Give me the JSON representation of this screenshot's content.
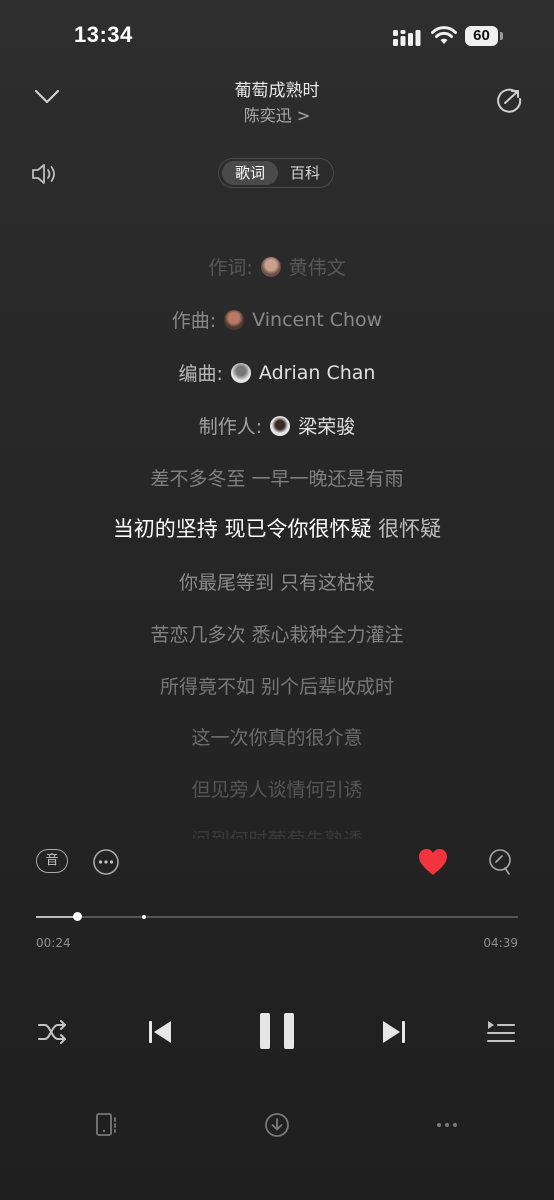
{
  "status_bar": {
    "time": "13:34",
    "battery": "60"
  },
  "header": {
    "song_title": "葡萄成熟时",
    "artist": "陈奕迅 >"
  },
  "tabs": [
    {
      "label": "歌词",
      "active": true
    },
    {
      "label": "百科",
      "active": false
    }
  ],
  "credits": [
    {
      "role": "作词:",
      "name": "黄伟文"
    },
    {
      "role": "作曲:",
      "name": "Vincent Chow"
    },
    {
      "role": "编曲:",
      "name": "Adrian Chan"
    },
    {
      "role": "制作人:",
      "name": "梁荣骏"
    }
  ],
  "lyrics": [
    "差不多冬至 一早一晚还是有雨",
    "当初的坚持 现已令你很怀疑 很怀疑",
    "你最尾等到 只有这枯枝",
    "苦恋几多次 悉心栽种全力灌注",
    "所得竟不如 别个后辈收成时",
    "这一次你真的很介意",
    "但见旁人谈情何引诱",
    "问到何时葡萄先熟透"
  ],
  "current_line": {
    "sung": "当初的坚持 现已令你很怀疑",
    "rest": " 很怀疑"
  },
  "controls": {
    "sound_effect_label": "音",
    "liked": true
  },
  "playback": {
    "current_time": "00:24",
    "total_time": "04:39",
    "progress": 0.086
  },
  "colors": {
    "like": "#f2343e",
    "accent_text": "#ffffff"
  }
}
